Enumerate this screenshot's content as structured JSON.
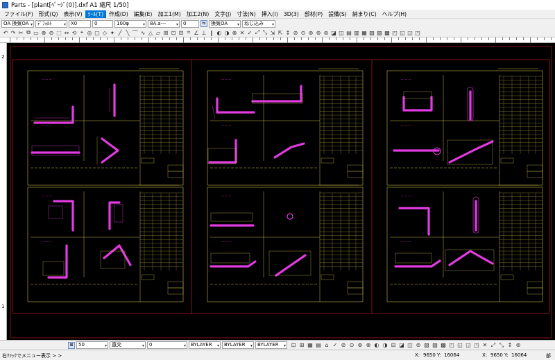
{
  "window": {
    "title": "Parts - [plant[ﾍﾟｰｼﾞ(0)].dxf A1 縮尺 1/50]"
  },
  "menu": [
    "ファイル(F)",
    "形式(Q)",
    "表示(V)",
    "ﾂｰﾙ(T)",
    "作成(D)",
    "編集(E)",
    "加工1(M)",
    "加工2(N)",
    "文字(J)",
    "寸法(N)",
    "挿入(I)",
    "3D(3)",
    "部材(P)",
    "設備(S)",
    "納まり(C)",
    "ヘルプ(H)"
  ],
  "menu_active_index": 3,
  "toolbar1": {
    "layer": "OA 換気OA",
    "linetype_top": "ﾃﾞﾌｫﾙﾄ",
    "coord_x": "X0",
    "coord_y": "0",
    "pipe": "100φ",
    "line_style": "8A.a---",
    "num": "0",
    "layer2": "換気OA",
    "snap": "ねじ込み"
  },
  "statusbar": {
    "scale": "50",
    "line_type": "直交",
    "value": "0",
    "layer_a": "BYLAYER",
    "layer_b": "BYLAYER",
    "layer_c": "BYLAYER"
  },
  "bottom": {
    "hint": "右ｸﾘｯｸでメニュー表示 > >",
    "coord_x_label": "X:",
    "coord_x": "9650",
    "coord_y_label": "Y:",
    "coord_y": "16064",
    "coord2_x_label": "X:",
    "coord2_x": "9650",
    "coord2_y_label": "Y:",
    "coord2_y": "16064",
    "part_label": "部"
  },
  "ruler": {
    "left_top": "2",
    "left_bottom": "1"
  },
  "colors": {
    "canvas": "#000000",
    "sheet_border": "#c8b84a",
    "frame": "#a01818",
    "pipe": "#e23be2",
    "text": "#c8b84a",
    "accent": "#0078d7"
  }
}
